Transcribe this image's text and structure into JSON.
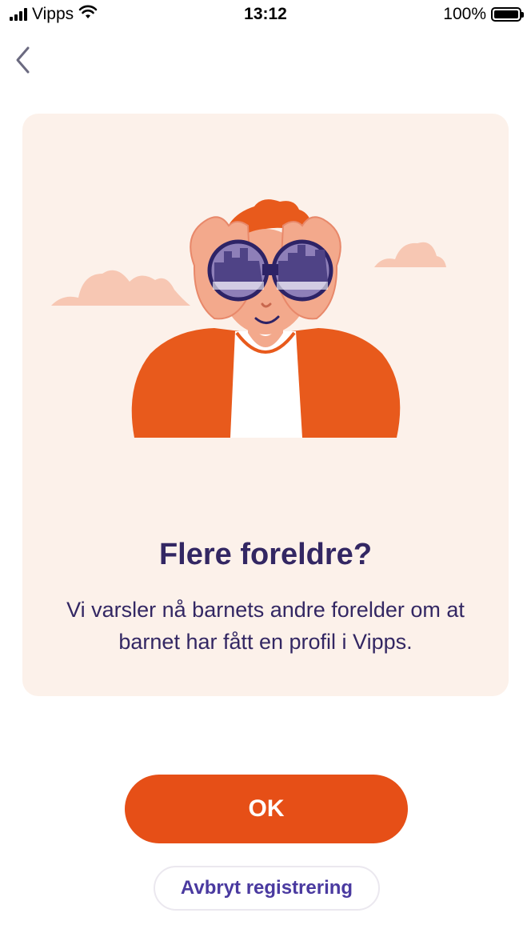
{
  "status_bar": {
    "carrier": "Vipps",
    "time": "13:12",
    "battery": "100%"
  },
  "nav": {
    "back_icon": "chevron-left-icon"
  },
  "card": {
    "title": "Flere foreldre?",
    "body": "Vi varsler nå barnets andre forelder om at barnet har fått en profil i Vipps.",
    "illustration": "person-with-binoculars"
  },
  "actions": {
    "ok_label": "OK",
    "cancel_label": "Avbryt registrering"
  },
  "colors": {
    "accent": "#e64f17",
    "title": "#332763",
    "card_background": "#fcf1ea",
    "secondary_text": "#4a3aa0"
  }
}
